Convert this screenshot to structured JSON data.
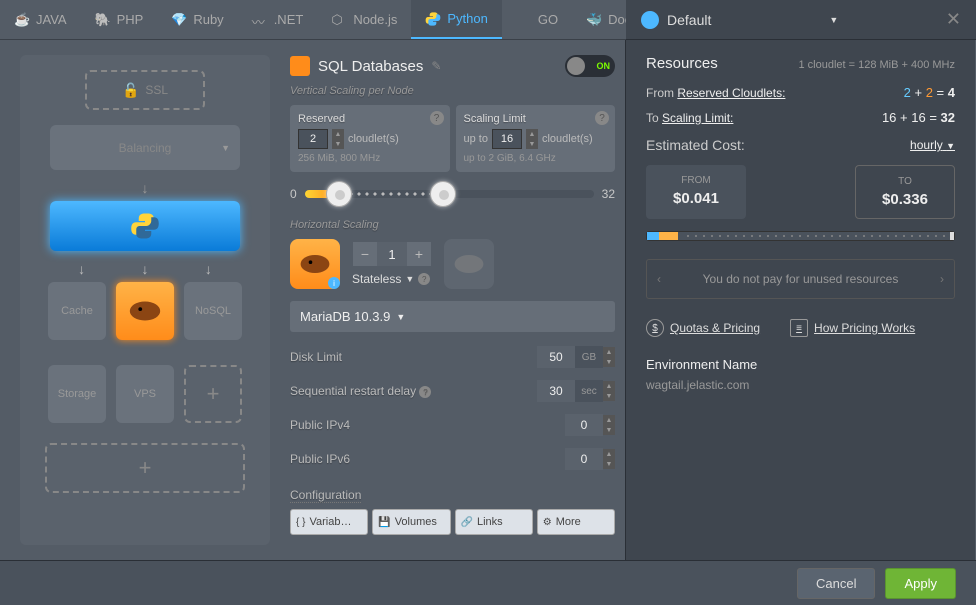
{
  "tabs": {
    "java": "JAVA",
    "php": "PHP",
    "ruby": "Ruby",
    "net": ".NET",
    "node": "Node.js",
    "python": "Python",
    "go": "GO",
    "docker": "Docker"
  },
  "region": {
    "label": "Default"
  },
  "topology": {
    "ssl": "SSL",
    "balancing": "Balancing",
    "cache": "Cache",
    "nosql": "NoSQL",
    "storage": "Storage",
    "vps": "VPS"
  },
  "section": {
    "title": "SQL Databases",
    "vscale": "Vertical Scaling per Node"
  },
  "toggle": {
    "on": "ON"
  },
  "reserved": {
    "title": "Reserved",
    "value": "2",
    "unit": "cloudlet(s)",
    "spec": "256 MiB, 800 MHz"
  },
  "limit": {
    "title": "Scaling Limit",
    "upto": "up to",
    "value": "16",
    "unit": "cloudlet(s)",
    "spec": "2 GiB, 6.4 GHz"
  },
  "slider": {
    "min": "0",
    "max": "32"
  },
  "hscale": {
    "title": "Horizontal Scaling",
    "count": "1",
    "mode": "Stateless"
  },
  "db": {
    "version": "MariaDB 10.3.9"
  },
  "fields": {
    "disk": {
      "label": "Disk Limit",
      "value": "50",
      "unit": "GB"
    },
    "delay": {
      "label": "Sequential restart delay",
      "value": "30",
      "unit": "sec"
    },
    "ipv4": {
      "label": "Public IPv4",
      "value": "0"
    },
    "ipv6": {
      "label": "Public IPv6",
      "value": "0"
    },
    "config": "Configuration"
  },
  "buttons": {
    "vars": "Variab…",
    "volumes": "Volumes",
    "links": "Links",
    "more": "More"
  },
  "resources": {
    "title": "Resources",
    "cloudlet_def": "1 cloudlet = 128 MiB + 400 MHz",
    "from_label": "From",
    "from_link": "Reserved Cloudlets:",
    "from_calc_a": "2",
    "from_calc_b": "2",
    "from_total": "4",
    "to_label": "To",
    "to_link": "Scaling Limit:",
    "to_calc_a": "16",
    "to_calc_b": "16",
    "to_total": "32",
    "cost_label": "Estimated Cost:",
    "period": "hourly",
    "price_from_lbl": "FROM",
    "price_from": "$0.041",
    "price_to_lbl": "TO",
    "price_to": "$0.336",
    "tip": "You do not pay for unused resources",
    "quotas": "Quotas & Pricing",
    "how": "How Pricing Works",
    "env_label": "Environment Name",
    "env_name": "wagtail.jelastic.com"
  },
  "footer": {
    "cancel": "Cancel",
    "apply": "Apply"
  }
}
